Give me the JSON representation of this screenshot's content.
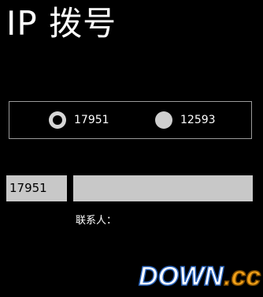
{
  "page": {
    "title": "IP 拨号"
  },
  "prefix_selector": {
    "options": [
      {
        "label": "17951",
        "selected": true
      },
      {
        "label": "12593",
        "selected": false
      }
    ]
  },
  "dial": {
    "prefix_value": "17951",
    "number_value": "",
    "contact_label": "联系人："
  },
  "watermark": {
    "text_main": "DOWN",
    "text_suffix": ".cc"
  },
  "colors": {
    "background": "#000000",
    "text": "#ffffff",
    "field_fill": "#c8c8c8",
    "group_border": "#9a9a9a",
    "watermark_blue": "#2a63b8",
    "watermark_orange": "#f3a21a"
  }
}
